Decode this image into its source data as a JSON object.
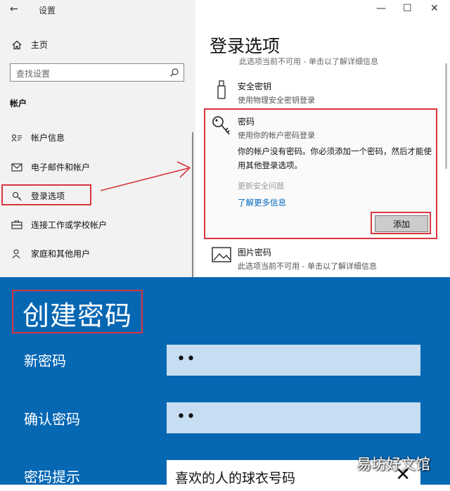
{
  "window": {
    "title": "设置",
    "back_icon": "arrow-left-icon",
    "controls": [
      "—",
      "☐",
      "✕"
    ]
  },
  "sidebar": {
    "home_label": "主页",
    "search_placeholder": "查找设置",
    "section_heading": "帐户",
    "items": [
      {
        "label": "帐户信息",
        "icon": "person-card-icon"
      },
      {
        "label": "电子邮件和帐户",
        "icon": "mail-icon"
      },
      {
        "label": "登录选项",
        "icon": "key-icon",
        "selected": true
      },
      {
        "label": "连接工作或学校帐户",
        "icon": "briefcase-icon"
      },
      {
        "label": "家庭和其他用户",
        "icon": "person-add-icon"
      }
    ]
  },
  "main": {
    "title": "登录选项",
    "cut_line": "此选项当前不可用 - 单击以了解详细信息",
    "options": {
      "security_key": {
        "title": "安全密钥",
        "subtitle": "使用物理安全密钥登录"
      },
      "password": {
        "title": "密码",
        "subtitle": "使用你的帐户密码登录",
        "description": "你的帐户没有密码。你必须添加一个密码，然后才能使用其他登录选项。",
        "link_disabled": "更新安全问题",
        "link_learn_more": "了解更多信息",
        "add_button": "添加"
      },
      "picture_password": {
        "title": "图片密码",
        "subtitle": "此选项当前不可用 - 单击以了解详细信息"
      }
    }
  },
  "create_password": {
    "title": "创建密码",
    "fields": [
      {
        "label": "新密码",
        "value": "••"
      },
      {
        "label": "确认密码",
        "value": "••"
      },
      {
        "label": "密码提示",
        "value": "喜欢的人的球衣号码"
      }
    ],
    "clear_icon": "✕"
  },
  "watermark": "易坊好文馆",
  "colors": {
    "accent_red": "#d9363e",
    "panel_blue": "#0667b3",
    "field_blue": "#c7ddf1",
    "link_blue": "#0067c0"
  }
}
